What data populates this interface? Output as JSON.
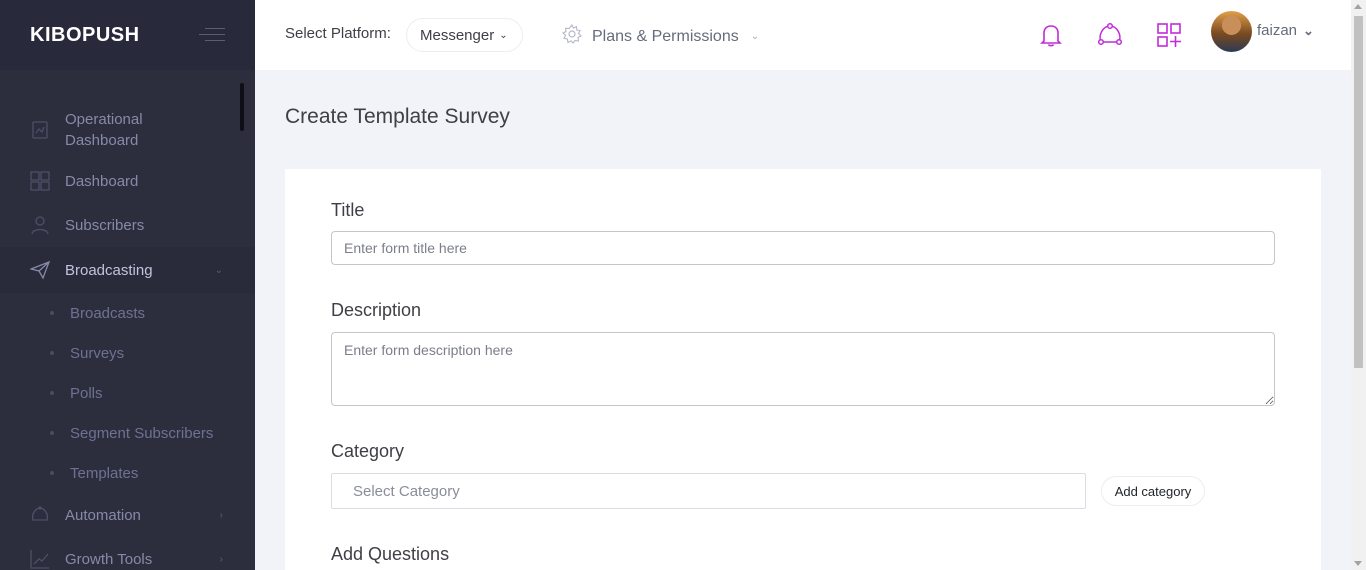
{
  "brand": {
    "name": "KIBOPUSH"
  },
  "sidebar": {
    "items": [
      {
        "label": "Operational Dashboard",
        "icon": "dashboard-chart-icon"
      },
      {
        "label": "Dashboard",
        "icon": "grid-icon"
      },
      {
        "label": "Subscribers",
        "icon": "user-icon"
      },
      {
        "label": "Broadcasting",
        "icon": "paper-plane-icon"
      },
      {
        "label": "Automation",
        "icon": "automation-icon"
      },
      {
        "label": "Growth Tools",
        "icon": "chart-line-icon"
      }
    ],
    "broadcasting_sub": [
      "Broadcasts",
      "Surveys",
      "Polls",
      "Segment Subscribers",
      "Templates"
    ]
  },
  "header": {
    "platform_label": "Select Platform:",
    "platform_value": "Messenger",
    "plans_label": "Plans & Permissions",
    "username": "faizan",
    "icons": [
      "bell-icon",
      "share-nodes-icon",
      "apps-add-icon"
    ],
    "accent_color": "#c12bd8"
  },
  "main": {
    "page_title": "Create Template Survey",
    "form": {
      "title_label": "Title",
      "title_placeholder": "Enter form title here",
      "description_label": "Description",
      "description_placeholder": "Enter form description here",
      "category_label": "Category",
      "category_placeholder": "Select Category",
      "add_category_label": "Add category",
      "add_questions_label": "Add Questions"
    }
  }
}
